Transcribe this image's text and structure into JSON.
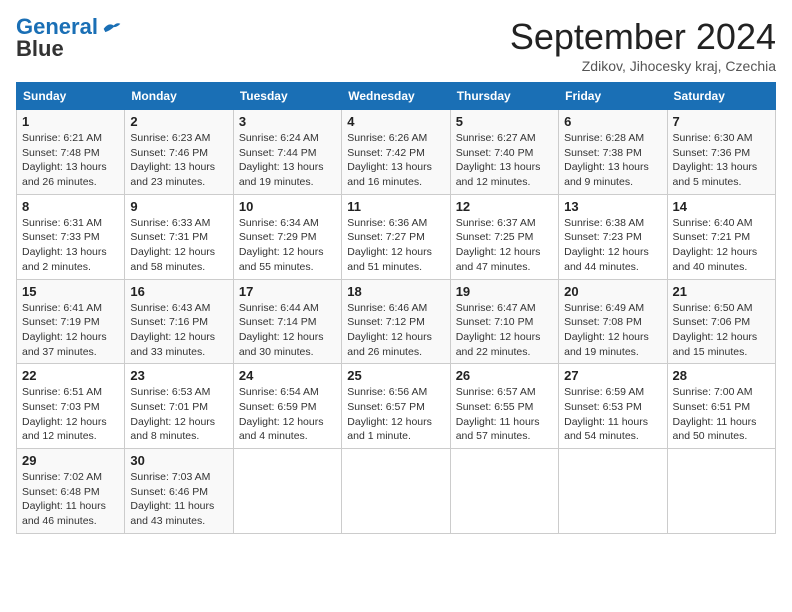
{
  "header": {
    "logo_line1": "General",
    "logo_line2": "Blue",
    "month_title": "September 2024",
    "subtitle": "Zdikov, Jihocesky kraj, Czechia"
  },
  "weekdays": [
    "Sunday",
    "Monday",
    "Tuesday",
    "Wednesday",
    "Thursday",
    "Friday",
    "Saturday"
  ],
  "weeks": [
    [
      {
        "day": 1,
        "info": "Sunrise: 6:21 AM\nSunset: 7:48 PM\nDaylight: 13 hours\nand 26 minutes."
      },
      {
        "day": 2,
        "info": "Sunrise: 6:23 AM\nSunset: 7:46 PM\nDaylight: 13 hours\nand 23 minutes."
      },
      {
        "day": 3,
        "info": "Sunrise: 6:24 AM\nSunset: 7:44 PM\nDaylight: 13 hours\nand 19 minutes."
      },
      {
        "day": 4,
        "info": "Sunrise: 6:26 AM\nSunset: 7:42 PM\nDaylight: 13 hours\nand 16 minutes."
      },
      {
        "day": 5,
        "info": "Sunrise: 6:27 AM\nSunset: 7:40 PM\nDaylight: 13 hours\nand 12 minutes."
      },
      {
        "day": 6,
        "info": "Sunrise: 6:28 AM\nSunset: 7:38 PM\nDaylight: 13 hours\nand 9 minutes."
      },
      {
        "day": 7,
        "info": "Sunrise: 6:30 AM\nSunset: 7:36 PM\nDaylight: 13 hours\nand 5 minutes."
      }
    ],
    [
      {
        "day": 8,
        "info": "Sunrise: 6:31 AM\nSunset: 7:33 PM\nDaylight: 13 hours\nand 2 minutes."
      },
      {
        "day": 9,
        "info": "Sunrise: 6:33 AM\nSunset: 7:31 PM\nDaylight: 12 hours\nand 58 minutes."
      },
      {
        "day": 10,
        "info": "Sunrise: 6:34 AM\nSunset: 7:29 PM\nDaylight: 12 hours\nand 55 minutes."
      },
      {
        "day": 11,
        "info": "Sunrise: 6:36 AM\nSunset: 7:27 PM\nDaylight: 12 hours\nand 51 minutes."
      },
      {
        "day": 12,
        "info": "Sunrise: 6:37 AM\nSunset: 7:25 PM\nDaylight: 12 hours\nand 47 minutes."
      },
      {
        "day": 13,
        "info": "Sunrise: 6:38 AM\nSunset: 7:23 PM\nDaylight: 12 hours\nand 44 minutes."
      },
      {
        "day": 14,
        "info": "Sunrise: 6:40 AM\nSunset: 7:21 PM\nDaylight: 12 hours\nand 40 minutes."
      }
    ],
    [
      {
        "day": 15,
        "info": "Sunrise: 6:41 AM\nSunset: 7:19 PM\nDaylight: 12 hours\nand 37 minutes."
      },
      {
        "day": 16,
        "info": "Sunrise: 6:43 AM\nSunset: 7:16 PM\nDaylight: 12 hours\nand 33 minutes."
      },
      {
        "day": 17,
        "info": "Sunrise: 6:44 AM\nSunset: 7:14 PM\nDaylight: 12 hours\nand 30 minutes."
      },
      {
        "day": 18,
        "info": "Sunrise: 6:46 AM\nSunset: 7:12 PM\nDaylight: 12 hours\nand 26 minutes."
      },
      {
        "day": 19,
        "info": "Sunrise: 6:47 AM\nSunset: 7:10 PM\nDaylight: 12 hours\nand 22 minutes."
      },
      {
        "day": 20,
        "info": "Sunrise: 6:49 AM\nSunset: 7:08 PM\nDaylight: 12 hours\nand 19 minutes."
      },
      {
        "day": 21,
        "info": "Sunrise: 6:50 AM\nSunset: 7:06 PM\nDaylight: 12 hours\nand 15 minutes."
      }
    ],
    [
      {
        "day": 22,
        "info": "Sunrise: 6:51 AM\nSunset: 7:03 PM\nDaylight: 12 hours\nand 12 minutes."
      },
      {
        "day": 23,
        "info": "Sunrise: 6:53 AM\nSunset: 7:01 PM\nDaylight: 12 hours\nand 8 minutes."
      },
      {
        "day": 24,
        "info": "Sunrise: 6:54 AM\nSunset: 6:59 PM\nDaylight: 12 hours\nand 4 minutes."
      },
      {
        "day": 25,
        "info": "Sunrise: 6:56 AM\nSunset: 6:57 PM\nDaylight: 12 hours\nand 1 minute."
      },
      {
        "day": 26,
        "info": "Sunrise: 6:57 AM\nSunset: 6:55 PM\nDaylight: 11 hours\nand 57 minutes."
      },
      {
        "day": 27,
        "info": "Sunrise: 6:59 AM\nSunset: 6:53 PM\nDaylight: 11 hours\nand 54 minutes."
      },
      {
        "day": 28,
        "info": "Sunrise: 7:00 AM\nSunset: 6:51 PM\nDaylight: 11 hours\nand 50 minutes."
      }
    ],
    [
      {
        "day": 29,
        "info": "Sunrise: 7:02 AM\nSunset: 6:48 PM\nDaylight: 11 hours\nand 46 minutes."
      },
      {
        "day": 30,
        "info": "Sunrise: 7:03 AM\nSunset: 6:46 PM\nDaylight: 11 hours\nand 43 minutes."
      },
      null,
      null,
      null,
      null,
      null
    ]
  ]
}
